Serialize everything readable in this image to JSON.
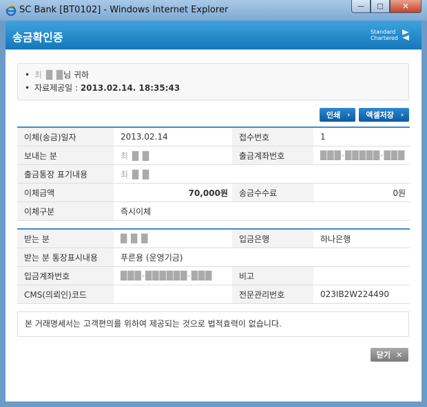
{
  "window": {
    "title": "SC Bank [BT0102] - Windows Internet Explorer",
    "minimize_glyph": "—",
    "maximize_glyph": "□",
    "close_glyph": "✕"
  },
  "header": {
    "title": "송금확인증",
    "logo_line1": "Standard",
    "logo_line2": "Chartered"
  },
  "info": {
    "recipient_masked": "최 █ █",
    "recipient_suffix": "님 귀하",
    "provided_label": "자료제공일 : ",
    "provided_value": "2013.02.14.  18:35:43"
  },
  "buttons": {
    "print_label": "인쇄",
    "excel_label": "엑셀저장",
    "close_label": "닫기",
    "arrow_glyph": "›",
    "close_glyph": "✕"
  },
  "transfer": {
    "rows": [
      {
        "l1": "이체(송금)일자",
        "v1": "2013.02.14",
        "l2": "접수번호",
        "v2": "1"
      },
      {
        "l1": "보내는 분",
        "v1": "최 █ █",
        "l2": "출금계좌번호",
        "v2": "███-█████-███"
      },
      {
        "l1": "출금통장 표기내용",
        "v1": "최 █ █"
      },
      {
        "l1": "이체금액",
        "v1": "70,000원",
        "l2": "송금수수료",
        "v2": "0원"
      },
      {
        "l1": "이체구분",
        "v1": "즉시이체"
      }
    ]
  },
  "recipient": {
    "rows": [
      {
        "l1": "받는 분",
        "v1": "█ █ █",
        "l2": "입금은행",
        "v2": "하나은행"
      },
      {
        "l1": "받는 분 통장표시내용",
        "v1": "푸른용 (운영기금)"
      },
      {
        "l1": "입금계좌번호",
        "v1": "███-██████-███",
        "l2": "비고",
        "v2": ""
      },
      {
        "l1": "CMS(의뢰인)코드",
        "v1": "",
        "l2": "전문관리번호",
        "v2": "023IB2W224490"
      }
    ]
  },
  "notice": "본 거래명세서는 고객편의를 위하여 제공되는 것으로 법적효력이 없습니다.",
  "colors": {
    "header_blue": "#1b84c8",
    "button_blue": "#1568ae",
    "accent_line": "#3b8ac9"
  }
}
